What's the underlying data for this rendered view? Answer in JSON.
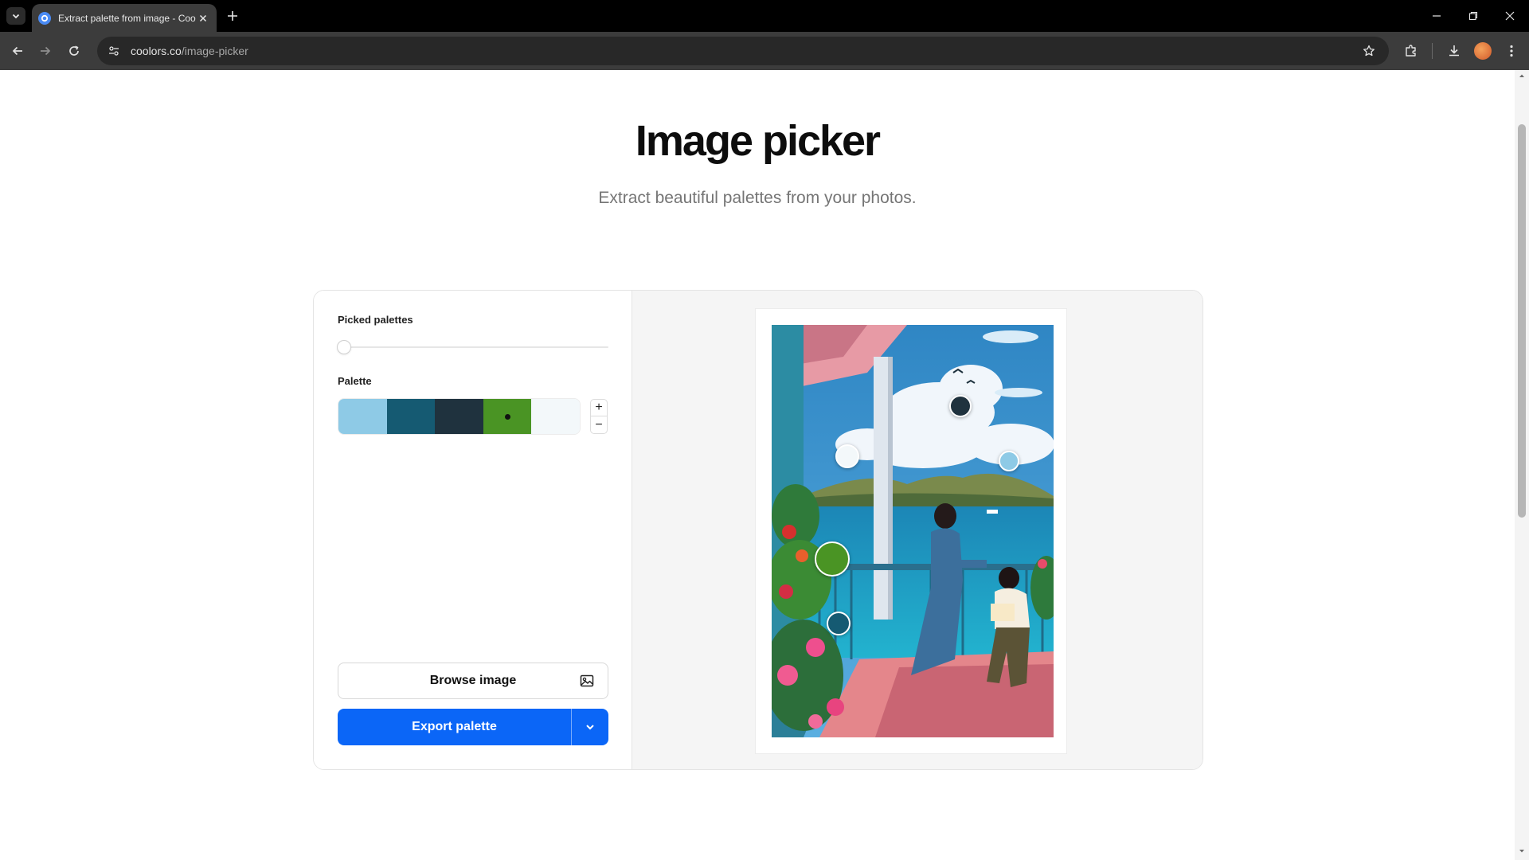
{
  "browser": {
    "tab_title": "Extract palette from image - Coolors",
    "url_domain": "coolors.co",
    "url_path": "/image-picker"
  },
  "page": {
    "title": "Image picker",
    "subtitle": "Extract beautiful palettes from your photos."
  },
  "sidebar": {
    "picked_palettes_label": "Picked palettes",
    "picked_palettes_value": 0,
    "palette_label": "Palette",
    "palette_colors": [
      "#8ECAE6",
      "#155A72",
      "#1F323E",
      "#4A9424",
      "#F3F8FA"
    ],
    "selected_swatch_index": 3,
    "add_symbol": "+",
    "remove_symbol": "−",
    "browse_label": "Browse image",
    "export_label": "Export palette"
  },
  "pickers": [
    {
      "color": "#1F323E"
    },
    {
      "color": "#F3F8FA"
    },
    {
      "color": "#8ECAE6"
    },
    {
      "color": "#4A9424"
    },
    {
      "color": "#155A72"
    }
  ],
  "icons": {
    "tab_list": "chevron-down-icon",
    "close": "close-icon",
    "new_tab": "plus-icon",
    "back": "back-arrow-icon",
    "forward": "forward-arrow-icon",
    "reload": "reload-icon",
    "site_info": "tune-icon",
    "bookmark": "star-icon",
    "extensions": "puzzle-icon",
    "downloads": "download-icon",
    "menu": "kebab-menu-icon",
    "browse": "image-icon",
    "export_dropdown": "chevron-down-icon"
  },
  "colors": {
    "accent": "#0B66F7",
    "browser_dark": "#3C3C3C",
    "tab_strip": "#000000"
  }
}
